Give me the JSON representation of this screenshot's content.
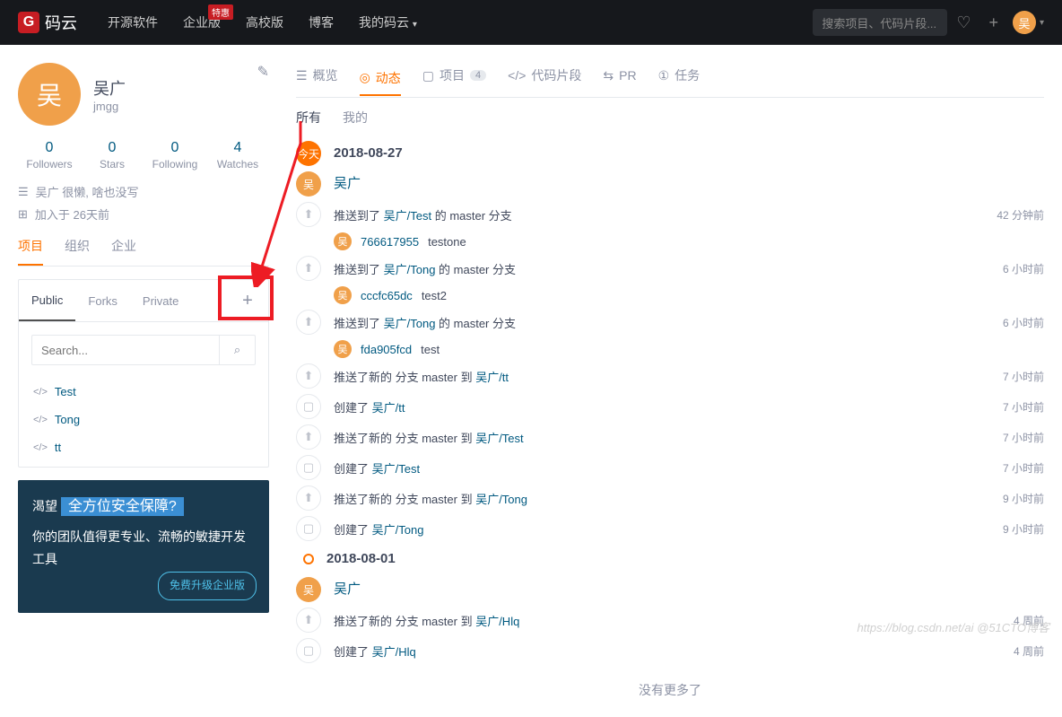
{
  "nav": {
    "brand": "码云",
    "items": [
      "开源软件",
      "企业版",
      "高校版",
      "博客",
      "我的码云"
    ],
    "badge": "特惠",
    "search_placeholder": "搜索项目、代码片段...",
    "avatar": "吴"
  },
  "profile": {
    "avatar": "吴",
    "name": "吴广",
    "username": "jmgg",
    "stats": [
      {
        "n": "0",
        "l": "Followers"
      },
      {
        "n": "0",
        "l": "Stars"
      },
      {
        "n": "0",
        "l": "Following"
      },
      {
        "n": "4",
        "l": "Watches"
      }
    ],
    "bio": "吴广 很懒, 啥也没写",
    "joined": "加入于 26天前"
  },
  "side_tabs": [
    "项目",
    "组织",
    "企业"
  ],
  "project_tabs": [
    "Public",
    "Forks",
    "Private"
  ],
  "search_placeholder": "Search...",
  "projects": [
    "Test",
    "Tong",
    "tt"
  ],
  "promo": {
    "pre": "渴望",
    "hl": "全方位安全保障?",
    "line": "你的团队值得更专业、流畅的敏捷开发工具",
    "btn": "免费升级企业版"
  },
  "main_tabs": [
    {
      "ico": "☰",
      "t": "概览"
    },
    {
      "ico": "◎",
      "t": "动态"
    },
    {
      "ico": "▢",
      "t": "项目",
      "b": "4"
    },
    {
      "ico": "</>",
      "t": "代码片段"
    },
    {
      "ico": "⇆",
      "t": "PR"
    },
    {
      "ico": "①",
      "t": "任务"
    }
  ],
  "sub_tabs": [
    "所有",
    "我的"
  ],
  "timeline": [
    {
      "type": "today",
      "label": "今天",
      "date": "2018-08-27"
    },
    {
      "type": "user",
      "avatar": "吴",
      "name": "吴广"
    },
    {
      "type": "push",
      "text": "推送到了 ",
      "repo": "吴广/Test",
      "suf": " 的 master 分支",
      "time": "42 分钟前",
      "commit": {
        "av": "吴",
        "sha": "766617955",
        "msg": "testone"
      }
    },
    {
      "type": "push",
      "text": "推送到了 ",
      "repo": "吴广/Tong",
      "suf": " 的 master 分支",
      "time": "6 小时前",
      "commit": {
        "av": "吴",
        "sha": "cccfc65dc",
        "msg": "test2"
      }
    },
    {
      "type": "push",
      "text": "推送到了 ",
      "repo": "吴广/Tong",
      "suf": " 的 master 分支",
      "time": "6 小时前",
      "commit": {
        "av": "吴",
        "sha": "fda905fcd",
        "msg": "test"
      }
    },
    {
      "type": "branch",
      "text": "推送了新的 分支 master 到 ",
      "repo": "吴广/tt",
      "time": "7 小时前"
    },
    {
      "type": "create",
      "text": "创建了 ",
      "repo": "吴广/tt",
      "time": "7 小时前"
    },
    {
      "type": "branch",
      "text": "推送了新的 分支 master 到 ",
      "repo": "吴广/Test",
      "time": "7 小时前"
    },
    {
      "type": "create",
      "text": "创建了 ",
      "repo": "吴广/Test",
      "time": "7 小时前"
    },
    {
      "type": "branch",
      "text": "推送了新的 分支 master 到 ",
      "repo": "吴广/Tong",
      "time": "9 小时前"
    },
    {
      "type": "create",
      "text": "创建了 ",
      "repo": "吴广/Tong",
      "time": "9 小时前"
    },
    {
      "type": "dotdate",
      "date": "2018-08-01"
    },
    {
      "type": "user",
      "avatar": "吴",
      "name": "吴广"
    },
    {
      "type": "branch",
      "text": "推送了新的 分支 master 到 ",
      "repo": "吴广/Hlq",
      "time": "4 周前"
    },
    {
      "type": "create",
      "text": "创建了 ",
      "repo": "吴广/Hlq",
      "time": "4 周前"
    }
  ],
  "no_more": "没有更多了",
  "watermark": "https://blog.csdn.net/ai @51CTO博客"
}
